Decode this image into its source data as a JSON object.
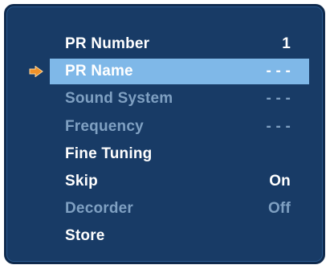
{
  "menu": {
    "items": [
      {
        "label": "PR Number",
        "value": "1",
        "state": "normal"
      },
      {
        "label": "PR Name",
        "value": "- - -",
        "state": "selected"
      },
      {
        "label": "Sound System",
        "value": "- - -",
        "state": "dimmed"
      },
      {
        "label": "Frequency",
        "value": "- - -",
        "state": "dimmed"
      },
      {
        "label": "Fine Tuning",
        "value": "",
        "state": "normal"
      },
      {
        "label": "Skip",
        "value": "On",
        "state": "normal"
      },
      {
        "label": "Decorder",
        "value": "Off",
        "state": "dimmed"
      },
      {
        "label": "Store",
        "value": "",
        "state": "normal"
      }
    ]
  },
  "icons": {
    "pointer": "arrow-right-icon"
  },
  "colors": {
    "panel_background": "#183b66",
    "selection_highlight": "#7fb8e8",
    "pointer": "#f0922a",
    "text_normal": "#ffffff",
    "text_dimmed": "#7fa0c2"
  }
}
